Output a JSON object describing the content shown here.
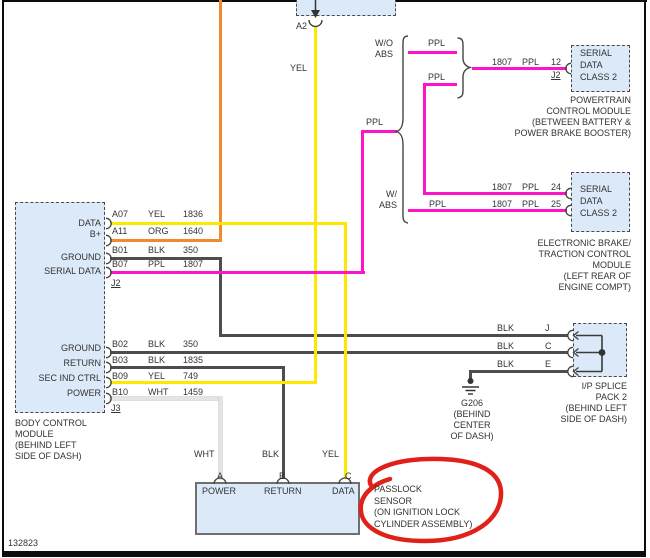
{
  "figure_number": "132823",
  "colors": {
    "yel": "#FFE800",
    "org": "#F08A2C",
    "ppl": "#FB14C8",
    "blk": "#4D4D4D",
    "wht": "#E4E4E4",
    "fill": "#DCE9F8",
    "red": "#E0211A"
  },
  "top": {
    "pin": "A2",
    "wire_label": "YEL"
  },
  "bcm": {
    "title_lines": [
      "BODY CONTROL",
      "MODULE",
      "(BEHIND LEFT",
      "SIDE OF DASH)"
    ],
    "j2": {
      "label": "J2",
      "pins": [
        {
          "name": "DATA",
          "pin": "A07",
          "color": "YEL",
          "circuit": "1836"
        },
        {
          "name": "B+",
          "pin": "A11",
          "color": "ORG",
          "circuit": "1640"
        },
        {
          "name": "GROUND",
          "pin": "B01",
          "color": "BLK",
          "circuit": "350"
        },
        {
          "name": "SERIAL DATA",
          "pin": "B07",
          "color": "PPL",
          "circuit": "1807"
        }
      ]
    },
    "j3": {
      "label": "J3",
      "pins": [
        {
          "name": "GROUND",
          "pin": "B02",
          "color": "BLK",
          "circuit": "350"
        },
        {
          "name": "RETURN",
          "pin": "B03",
          "color": "BLK",
          "circuit": "1835"
        },
        {
          "name": "SEC IND CTRL",
          "pin": "B09",
          "color": "YEL",
          "circuit": "749"
        },
        {
          "name": "POWER",
          "pin": "B10",
          "color": "WHT",
          "circuit": "1459"
        }
      ]
    }
  },
  "branch": {
    "serial_label": "PPL",
    "wo_abs_lines": [
      "W/O",
      "ABS"
    ],
    "w_abs_lines": [
      "W/",
      "ABS"
    ],
    "stub1_label": "PPL",
    "stub2_label": "PPL",
    "scd_lines": [
      "SERIAL",
      "DATA",
      "CLASS 2"
    ],
    "pcm_wire": {
      "circuit": "1807",
      "color": "PPL",
      "pin": "12"
    },
    "pcm_connector": "J2",
    "pcm_title_lines": [
      "POWERTRAIN",
      "CONTROL MODULE",
      "(BETWEEN BATTERY &",
      "POWER BRAKE BOOSTER)"
    ],
    "wire24": {
      "circuit": "1807",
      "color": "PPL",
      "pin": "24"
    },
    "wire25_label": "PPL",
    "wire25": {
      "circuit": "1807",
      "color": "PPL",
      "pin": "25"
    },
    "ebtcm_title_lines": [
      "ELECTRONIC BRAKE/",
      "TRACTION CONTROL",
      "MODULE",
      "(LEFT REAR OF",
      "ENGINE COMPT)"
    ]
  },
  "splice": {
    "rows": [
      {
        "color": "BLK",
        "pin": "J"
      },
      {
        "color": "BLK",
        "pin": "C"
      },
      {
        "color": "BLK",
        "pin": "E"
      }
    ],
    "title_lines": [
      "I/P SPLICE",
      "PACK 2",
      "(BEHIND LEFT",
      "SIDE OF DASH)"
    ]
  },
  "ground": {
    "title_lines": [
      "G206",
      "(BEHIND",
      "CENTER",
      "OF DASH)"
    ]
  },
  "passlock": {
    "wire_labels": [
      "WHT",
      "BLK",
      "YEL"
    ],
    "pin_letters": [
      "A",
      "B",
      "C"
    ],
    "pin_names": [
      "POWER",
      "RETURN",
      "DATA"
    ],
    "title_lines": [
      "PASSLOCK",
      "SENSOR",
      "(ON IGNITION LOCK",
      "CYLINDER ASSEMBLY)"
    ]
  }
}
